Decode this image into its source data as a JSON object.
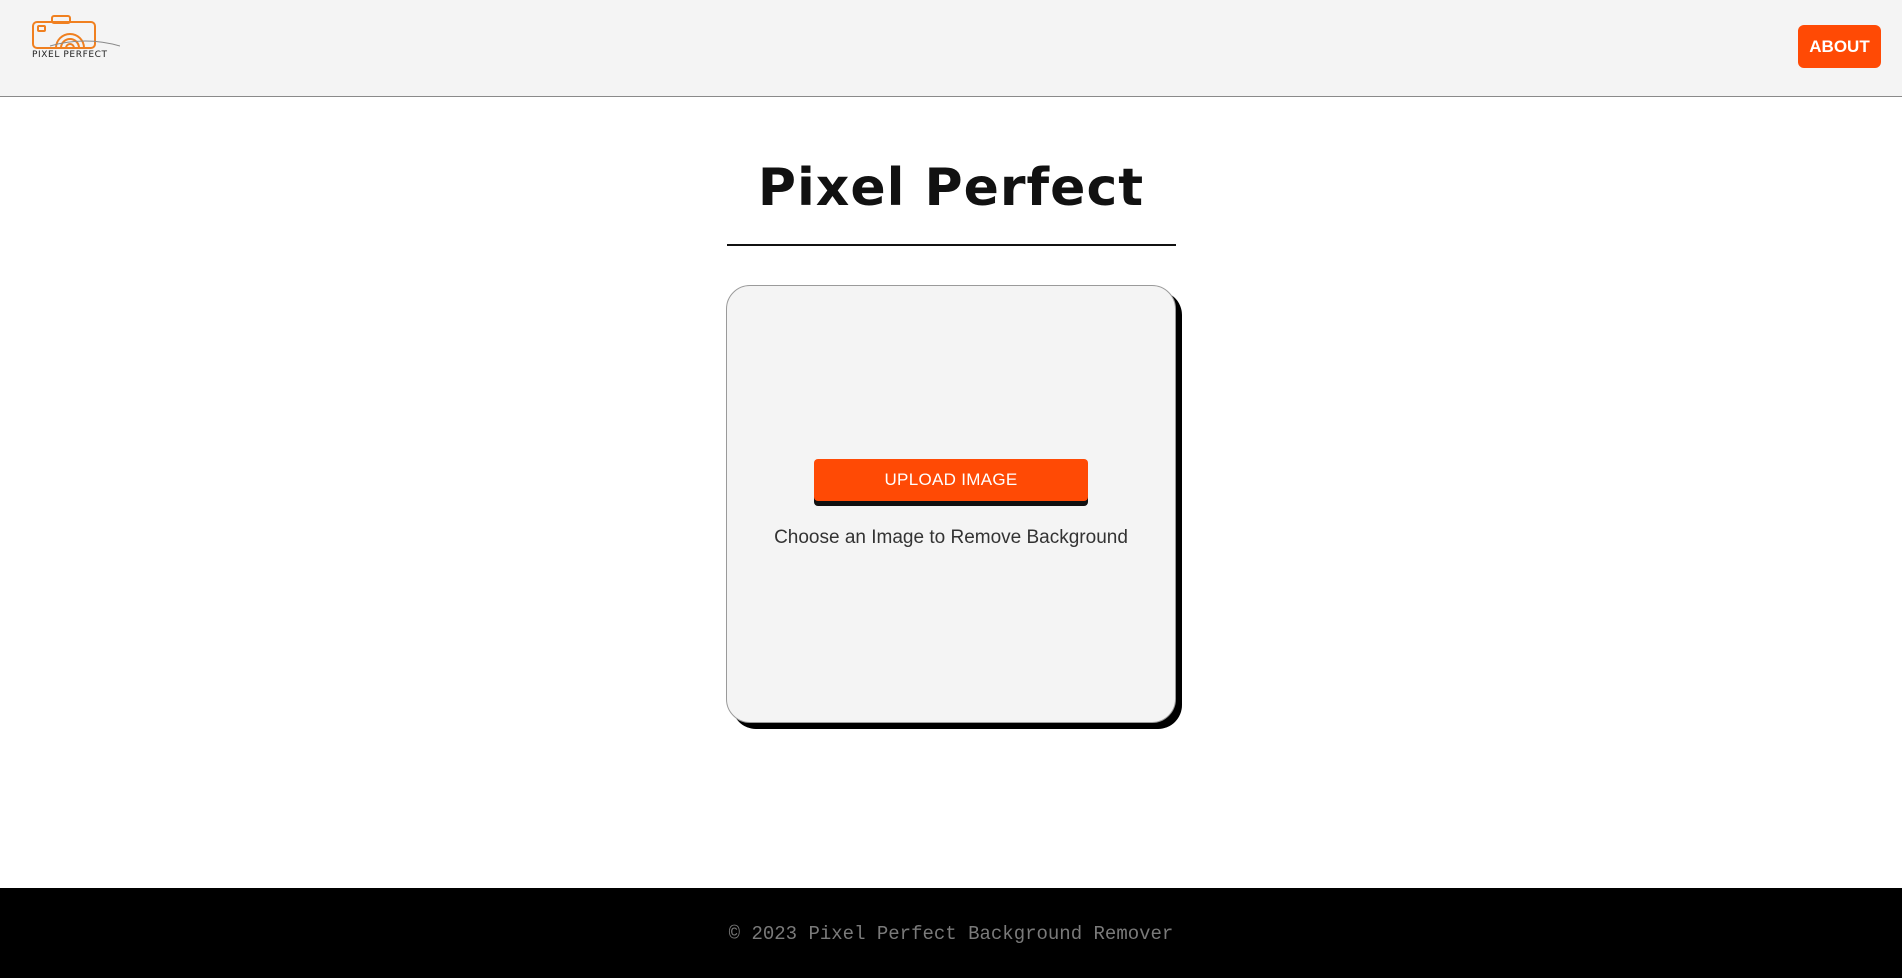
{
  "header": {
    "logo_text": "PIXEL PERFECT",
    "about_label": "ABOUT"
  },
  "main": {
    "title": "Pixel Perfect",
    "upload_button_label": "UPLOAD IMAGE",
    "upload_hint": "Choose an Image to Remove Background"
  },
  "footer": {
    "copyright": "© 2023 Pixel Perfect Background Remover"
  },
  "colors": {
    "accent": "#ff4a05",
    "header_bg": "#f4f4f4",
    "footer_bg": "#000000",
    "card_bg": "#f4f4f4"
  },
  "icons": {
    "logo": "camera-logo-icon"
  }
}
